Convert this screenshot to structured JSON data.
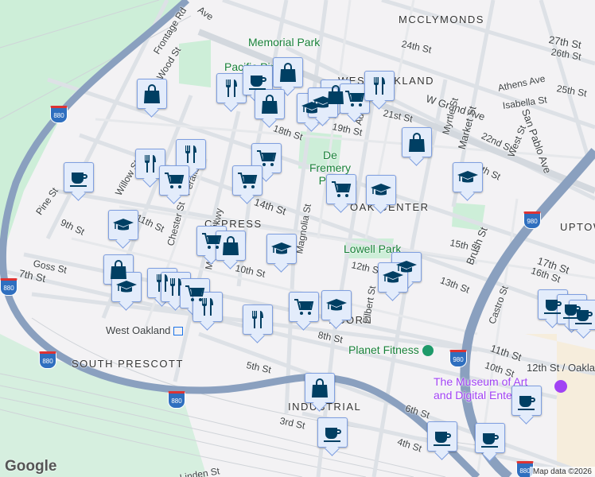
{
  "map": {
    "neighborhoods": [
      "MCCLYMONDS",
      "WEST OAKLAND",
      "CYPRESS",
      "OAK CENTER",
      "UPTOWN",
      "SOUTH PRESCOTT",
      "INDUSTRIAL",
      "ACORN"
    ],
    "parks": [
      "Memorial Park",
      "Pacific Pipe",
      "De Fremery Park",
      "Lowell Park"
    ],
    "streets": [
      "Frontage Rd",
      "Wood St",
      "Pine St",
      "9th St",
      "11th St",
      "Willow St",
      "Peralta St",
      "14th St",
      "18th St",
      "Chester St",
      "Goss St",
      "7th St",
      "10th St",
      "Mandela Pkwy",
      "8th St",
      "5th St",
      "3rd St",
      "24th St",
      "27th St",
      "26th St",
      "25th St",
      "Athens Ave",
      "Isabella St",
      "W Grand Ave",
      "21st St",
      "19th St",
      "22nd St",
      "20th St",
      "Adeline St",
      "Myrtle St",
      "Market St",
      "West St",
      "San Pablo Ave",
      "Magnolia St",
      "12th St",
      "15th St",
      "13th St",
      "Filbert St",
      "Brush St",
      "17th St",
      "16th St",
      "Castro St",
      "11th St",
      "10th St",
      "6th St",
      "4th St",
      "Ave",
      "Linden St"
    ],
    "poi": [
      "Planet Fitness",
      "The Museum of Art and Digital Entertai…"
    ],
    "transit": [
      "West Oakland",
      "12th St / Oakla"
    ],
    "highway_shields": [
      "880",
      "980"
    ],
    "attribution": "Map data ©2026",
    "logo": "Google"
  },
  "markers": [
    "shopping-bag",
    "restaurant",
    "coffee",
    "shopping-bag",
    "shopping-bag",
    "shopping-bag",
    "education",
    "education",
    "shopping-cart",
    "restaurant",
    "shopping-bag",
    "education",
    "shopping-cart",
    "education",
    "shopping-cart",
    "shopping-cart",
    "restaurant",
    "restaurant",
    "shopping-cart",
    "coffee",
    "education",
    "shopping-cart",
    "shopping-bag",
    "education",
    "shopping-bag",
    "education",
    "restaurant",
    "restaurant",
    "shopping-cart",
    "restaurant",
    "restaurant",
    "shopping-cart",
    "education",
    "education",
    "education",
    "coffee",
    "coffee",
    "coffee",
    "shopping-bag",
    "coffee",
    "coffee",
    "coffee",
    "coffee"
  ],
  "colors": {
    "marker_icon": "#003f63",
    "marker_bg": "#e3ecfb",
    "highway": "#8aa0bf",
    "park": "#cdeed8"
  }
}
